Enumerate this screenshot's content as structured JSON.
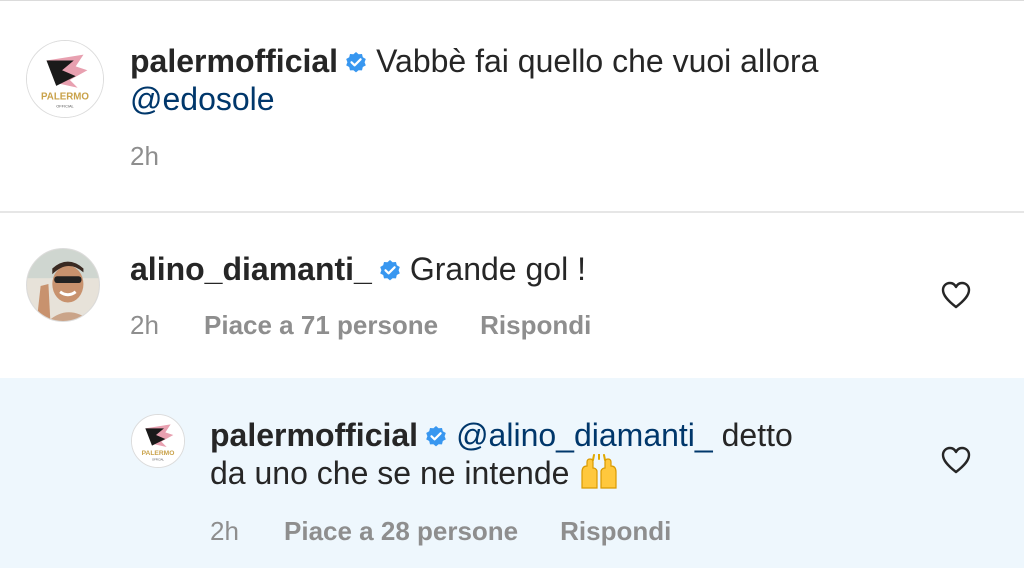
{
  "comments": [
    {
      "username": "palermofficial",
      "verified": true,
      "text": "Vabbè fai quello che vuoi allora",
      "mention": "@edosole",
      "time": "2h",
      "avatar": {
        "brand": "PALERMO",
        "sub": "OFFICIAL"
      }
    },
    {
      "username": "alino_diamanti_",
      "verified": true,
      "text": "Grande gol !",
      "time": "2h",
      "likes_label": "Piace a 71 persone",
      "reply_label": "Rispondi"
    },
    {
      "username": "palermofficial",
      "verified": true,
      "mention": "@alino_diamanti_",
      "text_line1": "detto",
      "text_line2": "da uno che se ne intende",
      "emoji": "raised-hands",
      "time": "2h",
      "likes_label": "Piace a 28 persone",
      "reply_label": "Rispondi",
      "avatar": {
        "brand": "PALERMO",
        "sub": "OFFICIAL"
      },
      "highlighted": true
    }
  ],
  "colors": {
    "mention": "#00376b",
    "verified": "#3897f0",
    "highlight_bg": "#eef7fd",
    "meta": "#8e8e8e"
  }
}
